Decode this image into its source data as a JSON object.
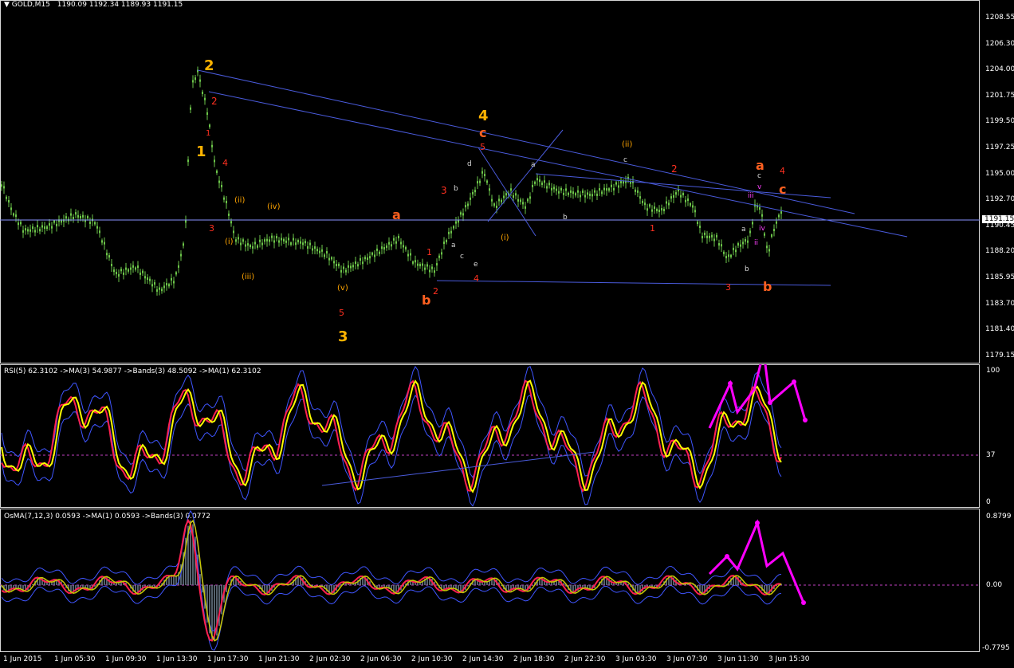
{
  "header": {
    "symbol_title": "GOLD,M15",
    "ohlc": "1190.09 1192.34 1189.93 1191.15"
  },
  "main_scale": [
    "1208.55",
    "1206.30",
    "1204.00",
    "1201.75",
    "1199.50",
    "1197.25",
    "1195.00",
    "1192.70",
    "1190.45",
    "1188.20",
    "1185.95",
    "1183.70",
    "1181.40",
    "1179.15"
  ],
  "current_price": "1191.15",
  "rsi": {
    "title": "RSI(5) 62.3102",
    "ma": "->MA(3) 54.9877",
    "bands": "->Bands(3) 48.5092",
    "ma1": "->MA(1) 62.3102",
    "scale_top": "100",
    "scale_mid": "37",
    "scale_bottom": "0"
  },
  "osma": {
    "title": "OsMA(7,12,3) 0.0593",
    "ma": "->MA(1) 0.0593",
    "bands": "->Bands(3) 0.0772",
    "scale_top": "0.8799",
    "scale_mid": "0.00",
    "scale_bottom": "-0.7795"
  },
  "time_axis": [
    "1 Jun 2015",
    "1 Jun 05:30",
    "1 Jun 09:30",
    "1 Jun 13:30",
    "1 Jun 17:30",
    "1 Jun 21:30",
    "2 Jun 02:30",
    "2 Jun 06:30",
    "2 Jun 10:30",
    "2 Jun 14:30",
    "2 Jun 18:30",
    "2 Jun 22:30",
    "3 Jun 03:30",
    "3 Jun 07:30",
    "3 Jun 11:30",
    "3 Jun 15:30"
  ],
  "wave_labels": {
    "w2": "2",
    "w1": "1",
    "w3": "3",
    "w4": "4",
    "c_top": "c",
    "a_top": "a",
    "c_right": "c",
    "b_mid": "b",
    "b_right": "b",
    "ii": "(ii)",
    "iv": "(iv)",
    "i": "(i)",
    "iii": "(iii)",
    "v": "(v)",
    "i2": "(i)",
    "ii2": "(ii)",
    "r2": "2",
    "r1": "1",
    "r4": "4",
    "r3": "3",
    "r5": "5",
    "r3b": "3",
    "r1b": "1",
    "r2b": "2",
    "r4b": "4",
    "r5b": "5",
    "r2c": "2",
    "r1c": "1",
    "r3c": "3",
    "r4c": "4",
    "sa": "a",
    "sb": "b",
    "sc": "c",
    "sd": "d",
    "se": "e",
    "sa2": "a",
    "sb2": "b",
    "sc2": "c",
    "sa3": "a",
    "sb3": "b",
    "sc3": "c",
    "iii_m": "iii",
    "ii_m": "ii",
    "iv_m": "iv",
    "v_m": "v"
  },
  "colors": {
    "candle": "#6dc64a",
    "trend": "#4a5bdc",
    "rsi": "#ffff00",
    "ma": "#ff2050",
    "bands": "#3f55ff",
    "arrow": "#ff00ff",
    "wave_orange": "#ffa500",
    "wave_red": "#ff3020"
  }
}
